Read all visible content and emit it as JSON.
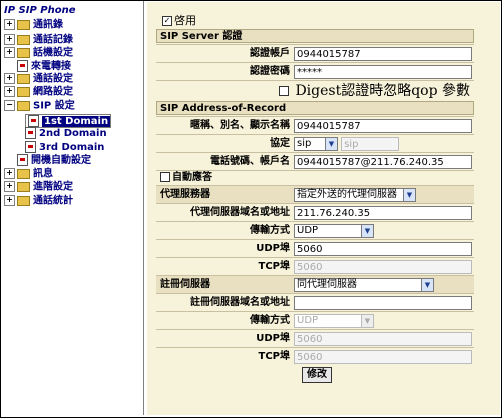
{
  "sidebar": {
    "root": "IP SIP Phone",
    "items": [
      {
        "label": "通訊錄",
        "kind": "folder"
      },
      {
        "label": "通話記錄",
        "kind": "folder"
      },
      {
        "label": "話機設定",
        "kind": "folder"
      },
      {
        "label": "來電轉接",
        "kind": "doc"
      },
      {
        "label": "通話設定",
        "kind": "folder"
      },
      {
        "label": "網路設定",
        "kind": "folder"
      },
      {
        "label": "SIP 設定",
        "kind": "folder-open"
      },
      {
        "label": "1st Domain",
        "kind": "doc",
        "selected": true
      },
      {
        "label": "2nd Domain",
        "kind": "doc"
      },
      {
        "label": "3rd Domain",
        "kind": "doc"
      },
      {
        "label": "開機自動設定",
        "kind": "doc"
      },
      {
        "label": "訊息",
        "kind": "folder"
      },
      {
        "label": "進階設定",
        "kind": "folder"
      },
      {
        "label": "通話統計",
        "kind": "folder"
      }
    ]
  },
  "form": {
    "enable_label": "啓用",
    "sip_server_header": "SIP Server 認證",
    "auth_account_label": "認證帳戶",
    "auth_account_value": "0944015787",
    "auth_password_label": "認證密碼",
    "auth_password_value": "*****",
    "ignore_qop_label": "Digest認證時忽略qop 參數",
    "aor_header": "SIP Address-of-Record",
    "display_name_label": "暱稱、別名、顯示名稱",
    "display_name_value": "0944015787",
    "protocol_label": "協定",
    "protocol_value": "sip",
    "protocol_text": "sip",
    "phone_label": "電話號碼、帳戶名",
    "phone_value": "0944015787@211.76.240.35",
    "auto_answer_label": "自動應答",
    "proxy_label": "代理服務器",
    "proxy_value": "指定外送的代理伺服器",
    "proxy_addr_label": "代理伺服器域名或地址",
    "proxy_addr_value": "211.76.240.35",
    "proxy_transport_label": "傳輸方式",
    "proxy_transport_value": "UDP",
    "proxy_udp_label": "UDP埠",
    "proxy_udp_value": "5060",
    "proxy_tcp_label": "TCP埠",
    "proxy_tcp_value": "5060",
    "registrar_label": "註冊伺服器",
    "registrar_value": "同代理伺服器",
    "reg_addr_label": "註冊伺服器域名或地址",
    "reg_addr_value": "",
    "reg_transport_label": "傳輸方式",
    "reg_transport_value": "UDP",
    "reg_udp_label": "UDP埠",
    "reg_udp_value": "5060",
    "reg_tcp_label": "TCP埠",
    "reg_tcp_value": "5060",
    "submit_label": "修改"
  }
}
